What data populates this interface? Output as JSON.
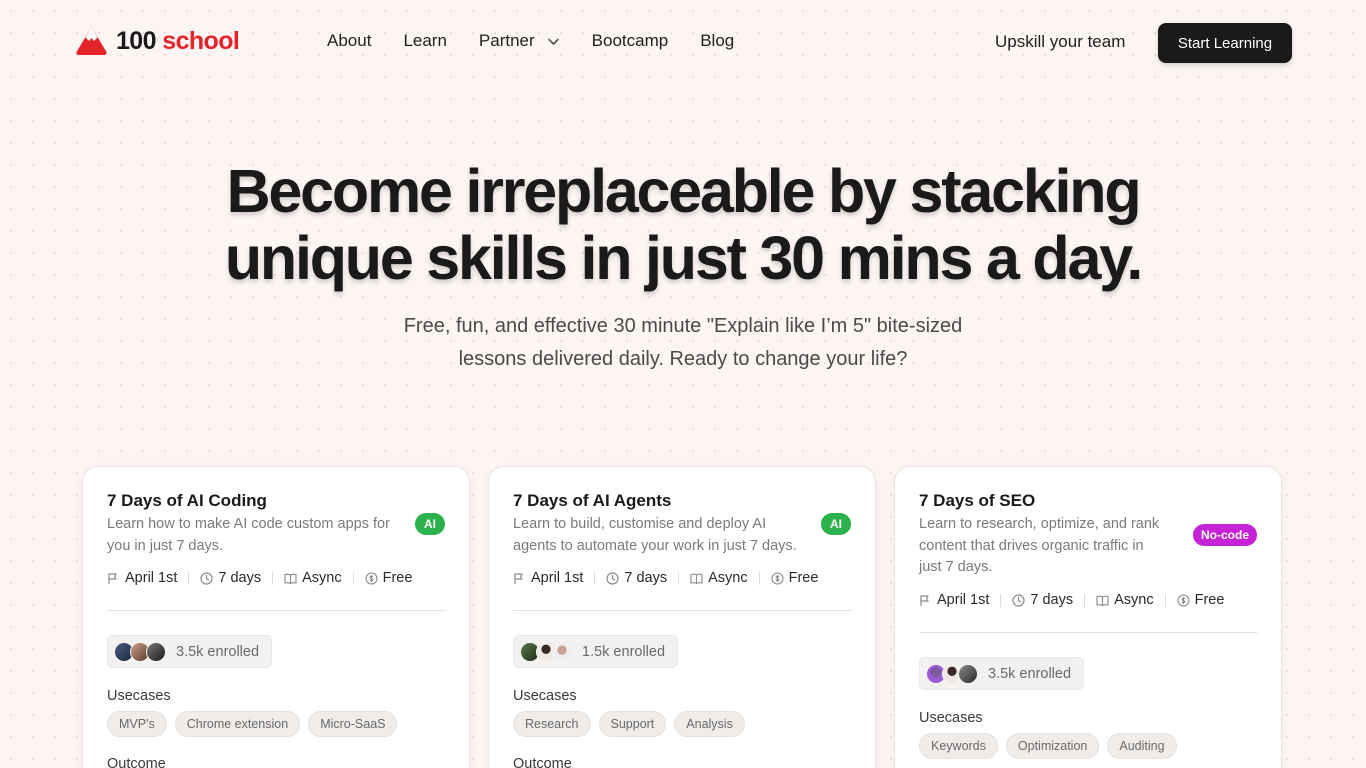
{
  "brand": {
    "num": "100",
    "word": "school",
    "red": "#e3242b"
  },
  "nav": {
    "links": [
      "About",
      "Learn",
      "Partner",
      "Bootcamp",
      "Blog"
    ],
    "partner_icon": "chevron-down-icon",
    "upskill": "Upskill your team",
    "cta": "Start Learning"
  },
  "hero": {
    "title_line1": "Become irreplaceable by stacking",
    "title_line2": "unique skills in just 30 mins a day.",
    "sub_line1": "Free, fun, and effective 30 minute \"Explain like I’m 5\" bite-sized",
    "sub_line2": "lessons delivered daily. Ready to change your life?"
  },
  "cards": [
    {
      "title": "7 Days of AI Coding",
      "desc_line1": "Learn how to make AI code custom apps for",
      "desc_line2": "you in just 7 days.",
      "desc_line3": "",
      "badge": "AI",
      "badge_color": "#2bb24c",
      "start": "April 1st",
      "duration": "7 days",
      "format": "Async",
      "price": "Free",
      "enrolled": "3.5k enrolled",
      "usecases_label": "Usecases",
      "tags": [
        "MVP's",
        "Chrome extension",
        "Micro-SaaS"
      ],
      "outcome_label": "Outcome"
    },
    {
      "title": "7 Days of AI Agents",
      "desc_line1": "Learn to build, customise and deploy AI",
      "desc_line2": "agents to automate your work in just 7 days.",
      "desc_line3": "",
      "badge": "AI",
      "badge_color": "#2bb24c",
      "start": "April 1st",
      "duration": "7 days",
      "format": "Async",
      "price": "Free",
      "enrolled": "1.5k enrolled",
      "usecases_label": "Usecases",
      "tags": [
        "Research",
        "Support",
        "Analysis"
      ],
      "outcome_label": "Outcome"
    },
    {
      "title": "7 Days of SEO",
      "desc_line1": "Learn to research, optimize, and rank",
      "desc_line2": "content that drives organic traffic in",
      "desc_line3": "just 7 days.",
      "badge": "No-code",
      "badge_color": "#c623d6",
      "start": "April 1st",
      "duration": "7 days",
      "format": "Async",
      "price": "Free",
      "enrolled": "3.5k enrolled",
      "usecases_label": "Usecases",
      "tags": [
        "Keywords",
        "Optimization",
        "Auditing"
      ],
      "outcome_label": "Outcome"
    }
  ]
}
